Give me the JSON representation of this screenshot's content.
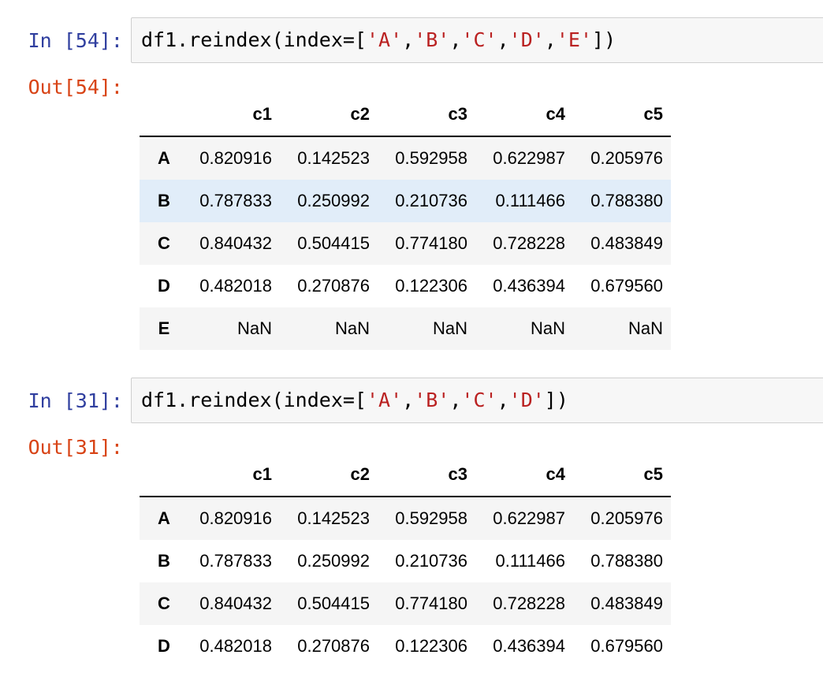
{
  "cells": [
    {
      "input_prompt": "In [54]:",
      "output_prompt": "Out[54]:",
      "code": {
        "prefix": "df1.reindex(index=[",
        "strings": [
          "'A'",
          "'B'",
          "'C'",
          "'D'",
          "'E'"
        ],
        "separator": ",",
        "suffix": "])"
      },
      "table": {
        "columns": [
          "c1",
          "c2",
          "c3",
          "c4",
          "c5"
        ],
        "rows": [
          {
            "index": "A",
            "values": [
              "0.820916",
              "0.142523",
              "0.592958",
              "0.622987",
              "0.205976"
            ]
          },
          {
            "index": "B",
            "values": [
              "0.787833",
              "0.250992",
              "0.210736",
              "0.111466",
              "0.788380"
            ],
            "highlighted": true
          },
          {
            "index": "C",
            "values": [
              "0.840432",
              "0.504415",
              "0.774180",
              "0.728228",
              "0.483849"
            ]
          },
          {
            "index": "D",
            "values": [
              "0.482018",
              "0.270876",
              "0.122306",
              "0.436394",
              "0.679560"
            ]
          },
          {
            "index": "E",
            "values": [
              "NaN",
              "NaN",
              "NaN",
              "NaN",
              "NaN"
            ]
          }
        ]
      }
    },
    {
      "input_prompt": "In [31]:",
      "output_prompt": "Out[31]:",
      "code": {
        "prefix": "df1.reindex(index=[",
        "strings": [
          "'A'",
          "'B'",
          "'C'",
          "'D'"
        ],
        "separator": ",",
        "suffix": "])"
      },
      "table": {
        "columns": [
          "c1",
          "c2",
          "c3",
          "c4",
          "c5"
        ],
        "rows": [
          {
            "index": "A",
            "values": [
              "0.820916",
              "0.142523",
              "0.592958",
              "0.622987",
              "0.205976"
            ]
          },
          {
            "index": "B",
            "values": [
              "0.787833",
              "0.250992",
              "0.210736",
              "0.111466",
              "0.788380"
            ]
          },
          {
            "index": "C",
            "values": [
              "0.840432",
              "0.504415",
              "0.774180",
              "0.728228",
              "0.483849"
            ]
          },
          {
            "index": "D",
            "values": [
              "0.482018",
              "0.270876",
              "0.122306",
              "0.436394",
              "0.679560"
            ]
          }
        ]
      }
    }
  ],
  "colors": {
    "in_prompt": "#303f9f",
    "out_prompt": "#d84315",
    "string_literal": "#ba2121",
    "row_stripe": "#f5f5f5",
    "row_hover": "#e1edf9"
  }
}
